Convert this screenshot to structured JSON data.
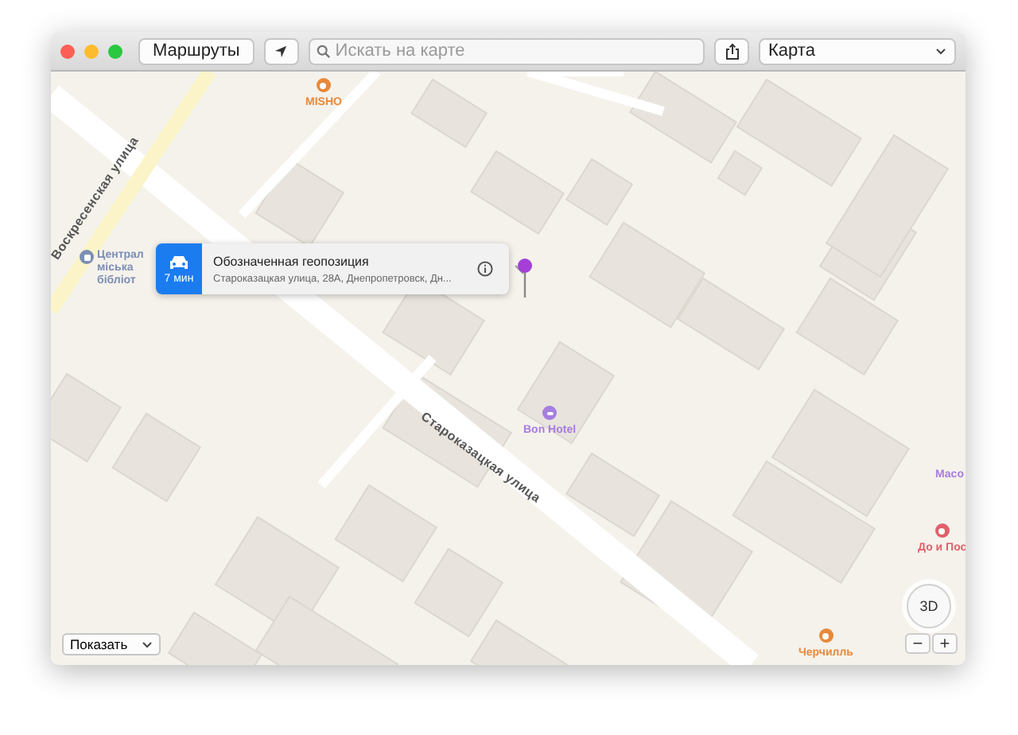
{
  "toolbar": {
    "routes_button": "Маршруты",
    "search": {
      "placeholder": "Искать на карте"
    },
    "map_type": "Карта"
  },
  "streets": [
    {
      "name": "Воскресенская улица"
    },
    {
      "name": "Староказацкая улица"
    }
  ],
  "pois": [
    {
      "kind": "food",
      "lines": [
        "MISHO"
      ],
      "color": "#e8893a"
    },
    {
      "kind": "library",
      "lines": [
        "Централ",
        "міська",
        "бібліот"
      ],
      "color": "#7c8fb5"
    },
    {
      "kind": "hotel",
      "lines": [
        "Bon Hotel"
      ],
      "color": "#a77de0"
    },
    {
      "kind": "shop",
      "lines": [
        "Масо"
      ],
      "color": "#a77de0"
    },
    {
      "kind": "food",
      "lines": [
        "До и Пос"
      ],
      "color": "#e0606a"
    },
    {
      "kind": "food",
      "lines": [
        "Черчилль"
      ],
      "color": "#e8893a"
    }
  ],
  "callout": {
    "eta": "7 мин",
    "title": "Обозначенная геопозиция",
    "address": "Староказацкая улица, 28А, Днепропетровск, Дн..."
  },
  "compass": {
    "label": "3D"
  },
  "zoom": {
    "out": "−",
    "in": "+"
  },
  "show_select": "Показать"
}
